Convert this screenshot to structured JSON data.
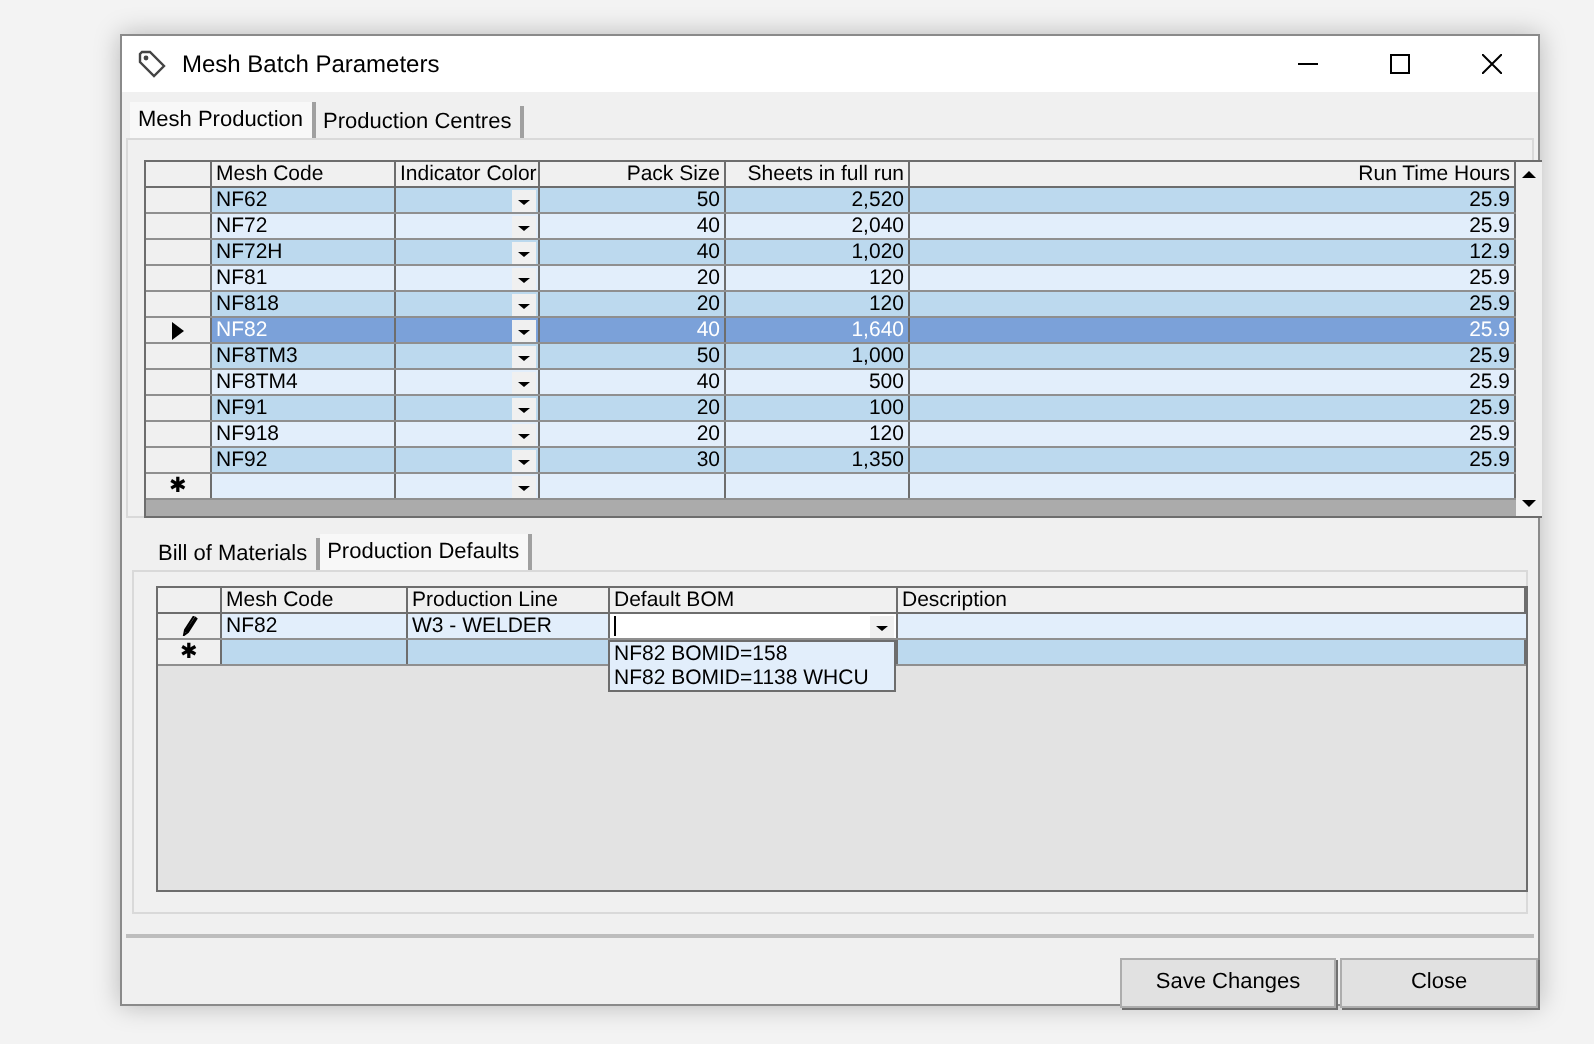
{
  "window": {
    "title": "Mesh Batch Parameters"
  },
  "tabs": [
    {
      "label": "Mesh Production",
      "selected": true
    },
    {
      "label": "Production Centres",
      "selected": false
    }
  ],
  "mesh_grid": {
    "columns": [
      "Mesh Code",
      "Indicator Color",
      "Pack Size",
      "Sheets in full run",
      "Run Time Hours"
    ],
    "rows": [
      {
        "mesh_code": "NF62",
        "pack_size": "50",
        "sheets": "2,520",
        "run_time": "25.9",
        "selected": false
      },
      {
        "mesh_code": "NF72",
        "pack_size": "40",
        "sheets": "2,040",
        "run_time": "25.9",
        "selected": false
      },
      {
        "mesh_code": "NF72H",
        "pack_size": "40",
        "sheets": "1,020",
        "run_time": "12.9",
        "selected": false
      },
      {
        "mesh_code": "NF81",
        "pack_size": "20",
        "sheets": "120",
        "run_time": "25.9",
        "selected": false
      },
      {
        "mesh_code": "NF818",
        "pack_size": "20",
        "sheets": "120",
        "run_time": "25.9",
        "selected": false
      },
      {
        "mesh_code": "NF82",
        "pack_size": "40",
        "sheets": "1,640",
        "run_time": "25.9",
        "selected": true
      },
      {
        "mesh_code": "NF8TM3",
        "pack_size": "50",
        "sheets": "1,000",
        "run_time": "25.9",
        "selected": false
      },
      {
        "mesh_code": "NF8TM4",
        "pack_size": "40",
        "sheets": "500",
        "run_time": "25.9",
        "selected": false
      },
      {
        "mesh_code": "NF91",
        "pack_size": "20",
        "sheets": "100",
        "run_time": "25.9",
        "selected": false
      },
      {
        "mesh_code": "NF918",
        "pack_size": "20",
        "sheets": "120",
        "run_time": "25.9",
        "selected": false
      },
      {
        "mesh_code": "NF92",
        "pack_size": "30",
        "sheets": "1,350",
        "run_time": "25.9",
        "selected": false
      }
    ],
    "new_row_marker": "✱"
  },
  "detail_tabs": [
    {
      "label": "Bill of Materials",
      "selected": false
    },
    {
      "label": "Production Defaults",
      "selected": true
    }
  ],
  "defaults_grid": {
    "columns": [
      "Mesh Code",
      "Production Line",
      "Default BOM",
      "Description"
    ],
    "rows": [
      {
        "mesh_code": "NF82",
        "production_line": "W3 - WELDER",
        "editing": true
      }
    ],
    "new_row_marker": "✱",
    "bom_options": [
      "NF82 BOMID=158",
      "NF82 BOMID=1138 WHCU"
    ]
  },
  "buttons": [
    "Save Changes",
    "Close"
  ]
}
